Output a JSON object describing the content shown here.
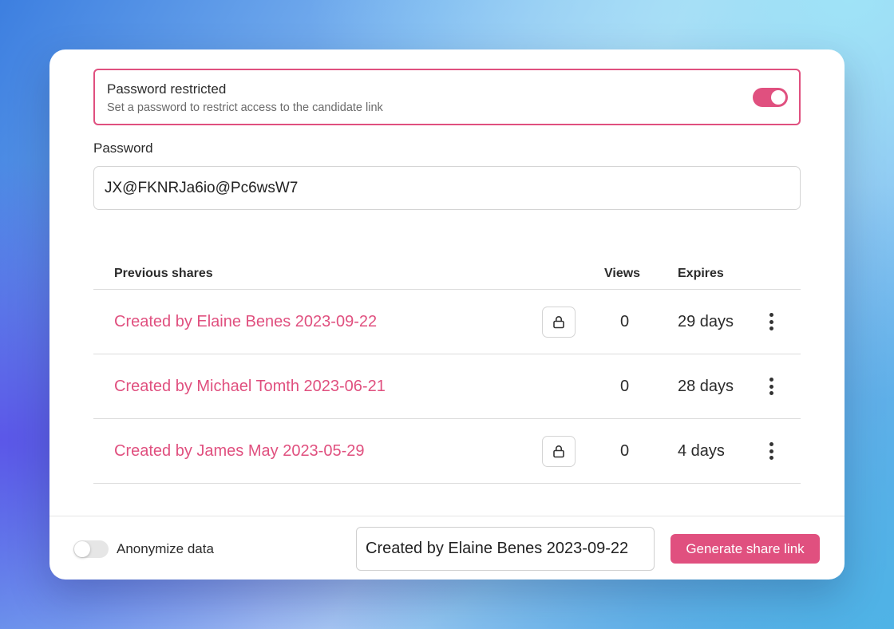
{
  "password_restriction": {
    "title": "Password restricted",
    "description": "Set a password to restrict access to the candidate link",
    "enabled": true
  },
  "password": {
    "label": "Password",
    "value": "JX@FKNRJa6io@Pc6wsW7"
  },
  "shares": {
    "headers": {
      "name": "Previous shares",
      "views": "Views",
      "expires": "Expires"
    },
    "rows": [
      {
        "name": "Created by Elaine Benes 2023-09-22",
        "locked": true,
        "views": "0",
        "expires": "29 days"
      },
      {
        "name": "Created by Michael Tomth 2023-06-21",
        "locked": false,
        "views": "0",
        "expires": "28 days"
      },
      {
        "name": "Created by James May 2023-05-29",
        "locked": true,
        "views": "0",
        "expires": "4 days"
      }
    ]
  },
  "footer": {
    "anonymize_label": "Anonymize data",
    "anonymize_enabled": false,
    "selected_share": "Created by Elaine Benes 2023-09-22",
    "generate_label": "Generate share link"
  },
  "colors": {
    "accent": "#e0507f"
  },
  "icons": {
    "lock": "lock-icon",
    "more": "more-vertical-icon"
  }
}
